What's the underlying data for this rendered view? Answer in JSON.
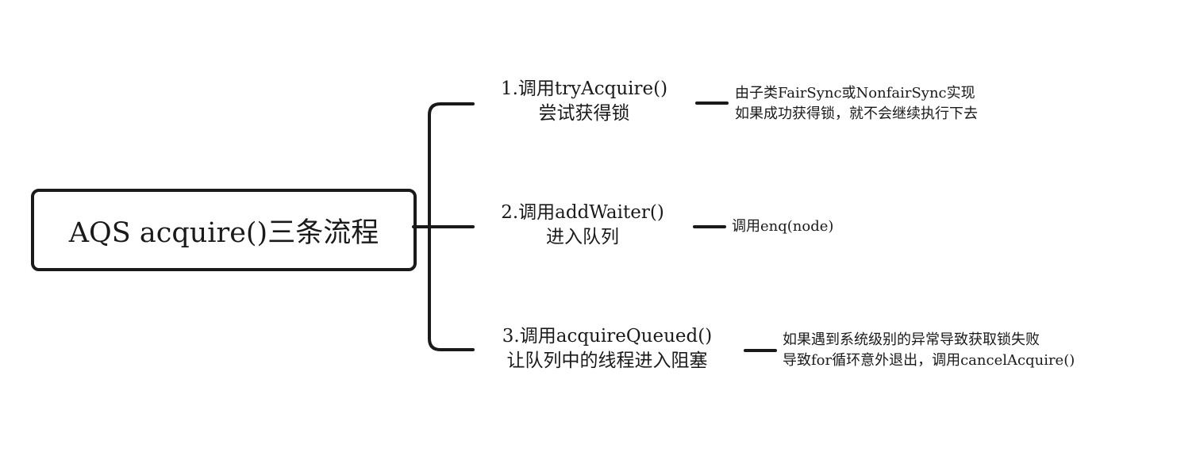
{
  "root": {
    "title": "AQS acquire()三条流程"
  },
  "branches": [
    {
      "title": "1.调用tryAcquire()",
      "subtitle": "尝试获得锁",
      "notes": [
        "由子类FairSync或NonfairSync实现",
        "如果成功获得锁，就不会继续执行下去"
      ]
    },
    {
      "title": "2.调用addWaiter()",
      "subtitle": "进入队列",
      "notes": [
        "调用enq(node)"
      ]
    },
    {
      "title": "3.调用acquireQueued()",
      "subtitle": "让队列中的线程进入阻塞",
      "notes": [
        "如果遇到系统级别的异常导致获取锁失败",
        "导致for循环意外退出，调用cancelAcquire()"
      ]
    }
  ],
  "colors": {
    "line": "#1a1a1a",
    "text": "#1a1a1a",
    "background": "#ffffff"
  }
}
